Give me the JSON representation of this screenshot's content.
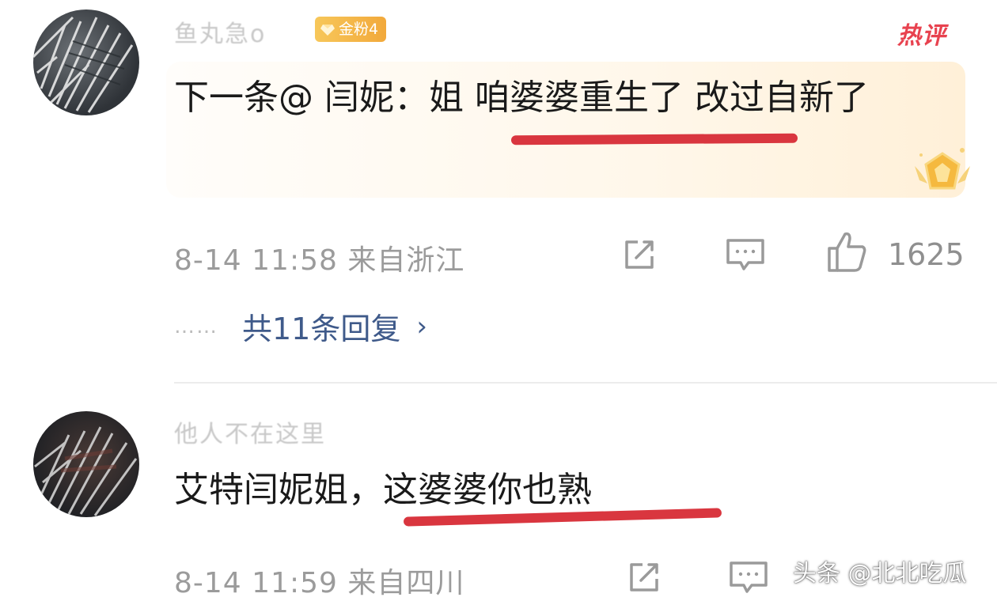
{
  "comments": [
    {
      "username": "鱼丸急o",
      "badge": "金粉4",
      "hot_label": "热评",
      "content": "下一条@ 闫妮：姐 咱婆婆重生了 改过自新了",
      "meta": "8-14 11:58  来自浙江",
      "like_count": "1625",
      "replies_label": "共11条回复",
      "replies_dots": "……"
    },
    {
      "username": "他人不在这里",
      "content": "艾特闫妮姐，这婆婆你也熟",
      "meta": "8-14 11:59  来自四川"
    }
  ],
  "watermark": "头条 @北北吃瓜",
  "colors": {
    "underline": "#d9363f",
    "link": "#3f5a8a",
    "hot": "#e8424f",
    "badge": "#f2a93b",
    "meta": "#9b9b9b"
  },
  "icons": [
    "share-icon",
    "comment-icon",
    "thumbs-up-icon",
    "chevron-right-icon",
    "medal-icon",
    "gem-icon"
  ]
}
